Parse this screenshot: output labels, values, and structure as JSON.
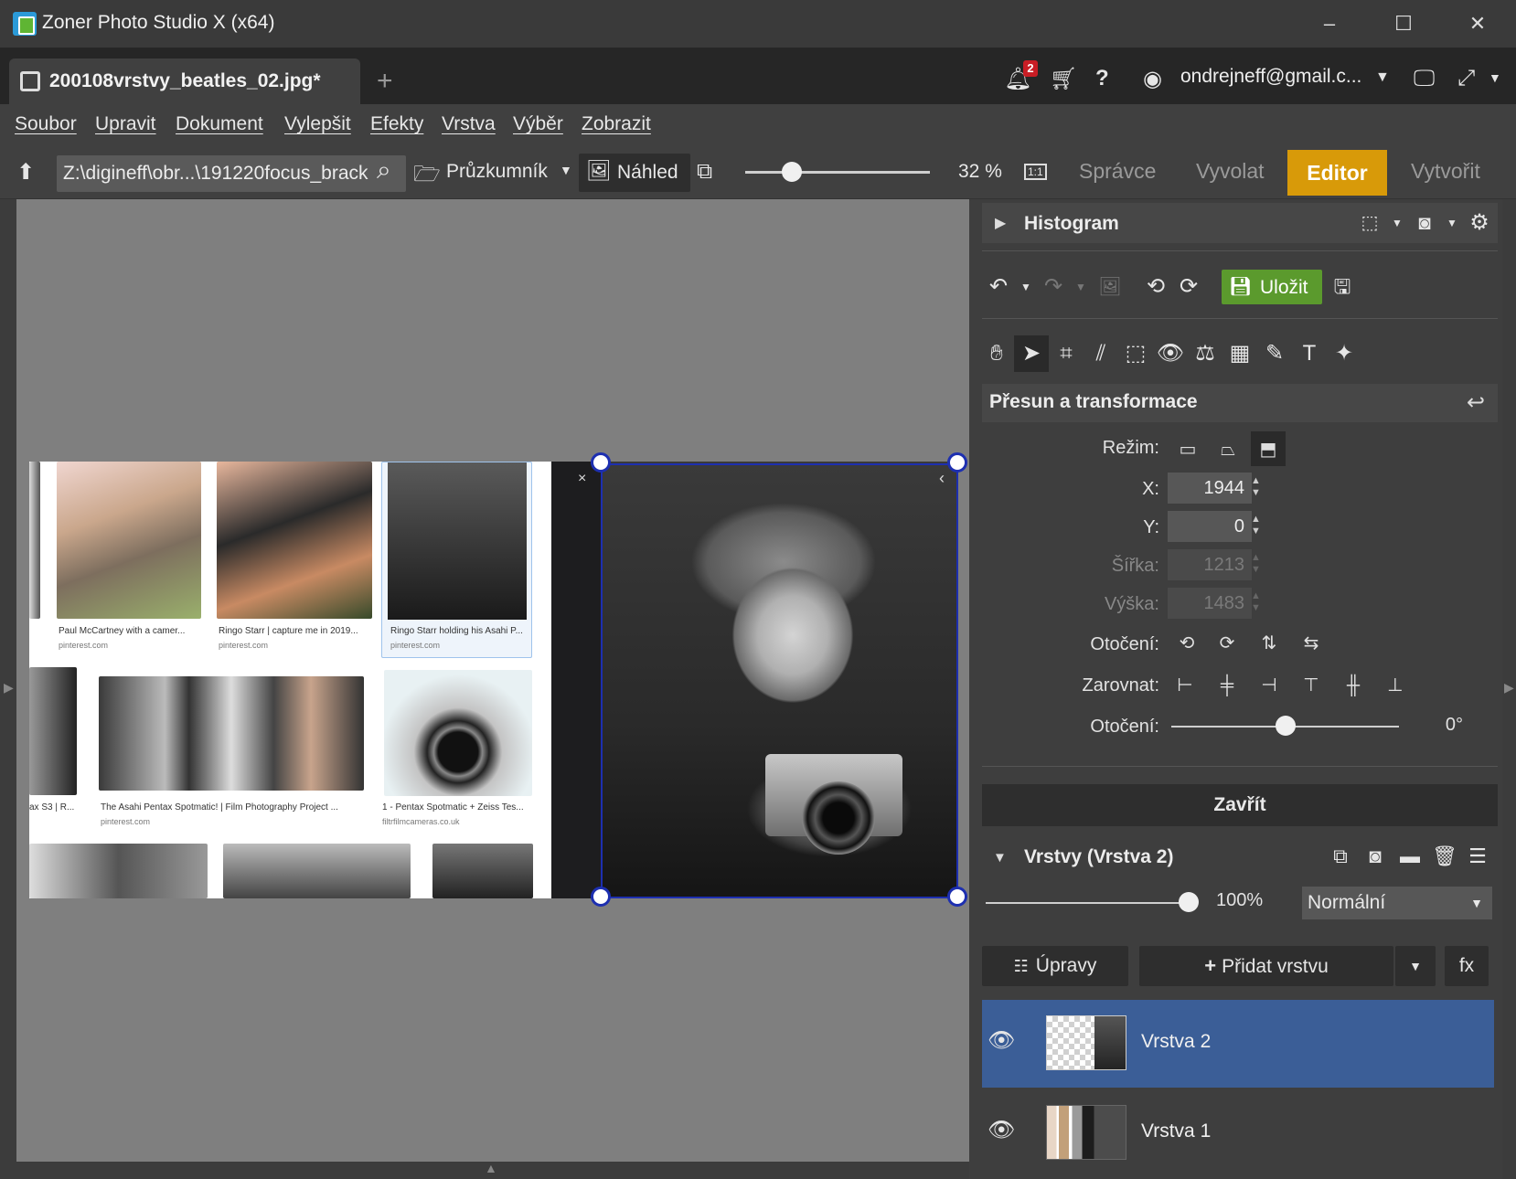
{
  "window": {
    "title": "Zoner Photo Studio X (x64)",
    "min_icon": "minimize-icon",
    "max_icon": "maximize-icon",
    "close_icon": "close-icon"
  },
  "tabbar": {
    "doc_tab": "200108vrstvy_beatles_02.jpg*",
    "notifications_count": "2",
    "user_email": "ondrejneff@gmail.c..."
  },
  "menu": {
    "items": [
      "Soubor",
      "Upravit",
      "Dokument",
      "Vylepšit",
      "Efekty",
      "Vrstva",
      "Výběr",
      "Zobrazit"
    ]
  },
  "toolbar": {
    "path": "Z:\\digineff\\obr...\\191220focus_brack",
    "browser_label": "Průzkumník",
    "preview_label": "Náhled",
    "zoom_value": "32 %",
    "zoom_fraction": 0.25,
    "one_to_one": "1:1",
    "modes": [
      "Správce",
      "Vyvolat",
      "Editor",
      "Vytvořit"
    ],
    "active_mode": "Editor",
    "accent_color": "#d89a09"
  },
  "canvas": {
    "close_mark": "×",
    "collapse_mark": "‹",
    "thumbs": [
      {
        "caption": "Paul McCartney with a camer...",
        "source": "pinterest.com"
      },
      {
        "caption": "Ringo Starr | capture me in 2019...",
        "source": "pinterest.com"
      },
      {
        "caption": "Ringo Starr holding his Asahi P...",
        "source": "pinterest.com"
      },
      {
        "caption": "ax S3 | R...",
        "source": ""
      },
      {
        "caption": "The Asahi Pentax Spotmatic! | Film Photography Project ...",
        "source": "pinterest.com"
      },
      {
        "caption": "1 - Pentax Spotmatic + Zeiss Tes...",
        "source": "filtrfilmcameras.co.uk"
      }
    ]
  },
  "panel": {
    "histogram_title": "Histogram",
    "save_label": "Uložit",
    "save_color": "#5b9a2d",
    "transform_title": "Přesun a transformace",
    "mode_label": "Režim:",
    "x_label": "X:",
    "x_value": "1944",
    "y_label": "Y:",
    "y_value": "0",
    "width_label": "Šířka:",
    "width_value": "1213",
    "height_label": "Výška:",
    "height_value": "1483",
    "rotate_label": "Otočení:",
    "align_label": "Zarovnat:",
    "rotation_label": "Otočení:",
    "rotation_value": "0°",
    "rotation_fraction": 0.5,
    "close_label": "Zavřít",
    "layers_title": "Vrstvy (Vrstva 2)",
    "opacity_value": "100%",
    "opacity_fraction": 1.0,
    "blend_mode": "Normální",
    "adjust_label": "Úpravy",
    "add_layer_label": "Přidat vrstvu",
    "fx_label": "fx",
    "layers": [
      {
        "name": "Vrstva 2",
        "selected": true
      },
      {
        "name": "Vrstva 1",
        "selected": false
      }
    ],
    "selected_color": "#3b5e97"
  }
}
